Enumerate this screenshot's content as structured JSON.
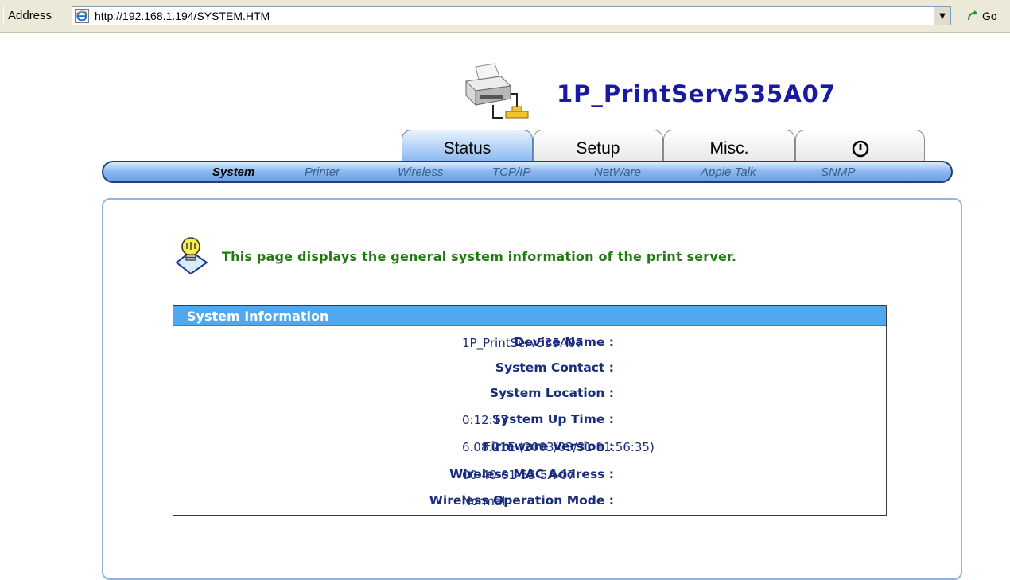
{
  "browser": {
    "address_label": "Address",
    "url": "http://192.168.1.194/SYSTEM.HTM",
    "go_label": "Go"
  },
  "header": {
    "device_title": "1P_PrintServ535A07"
  },
  "tabs": [
    {
      "label": "Status",
      "active": true
    },
    {
      "label": "Setup",
      "active": false
    },
    {
      "label": "Misc.",
      "active": false
    },
    {
      "label": "",
      "icon": "power-icon",
      "active": false
    }
  ],
  "subnav": [
    {
      "label": "System",
      "active": true
    },
    {
      "label": "Printer",
      "active": false
    },
    {
      "label": "Wireless",
      "active": false
    },
    {
      "label": "TCP/IP",
      "active": false
    },
    {
      "label": "NetWare",
      "active": false
    },
    {
      "label": "Apple Talk",
      "active": false
    },
    {
      "label": "SNMP",
      "active": false
    }
  ],
  "main": {
    "tip": "This page displays the general system information of the print server.",
    "section_title": "System Information",
    "rows": [
      {
        "label": "Device Name :",
        "value": "1P_PrintServ535A07"
      },
      {
        "label": "System Contact :",
        "value": ""
      },
      {
        "label": "System Location :",
        "value": ""
      },
      {
        "label": "System Up Time :",
        "value": "0:12:17"
      },
      {
        "label": "Firmware Version :",
        "value": "6.08.21E (2003/03/31 11:56:35)"
      },
      {
        "label": "Wireless MAC Address :",
        "value": "00-40-01-53-5A-07"
      },
      {
        "label": "Wireless Operation Mode :",
        "value": "Normal"
      }
    ]
  },
  "colors": {
    "title": "#1a1aa0",
    "tip_text": "#1f7a10",
    "section_header_bg": "#4fa8f0",
    "row_text": "#1a2d7a"
  }
}
